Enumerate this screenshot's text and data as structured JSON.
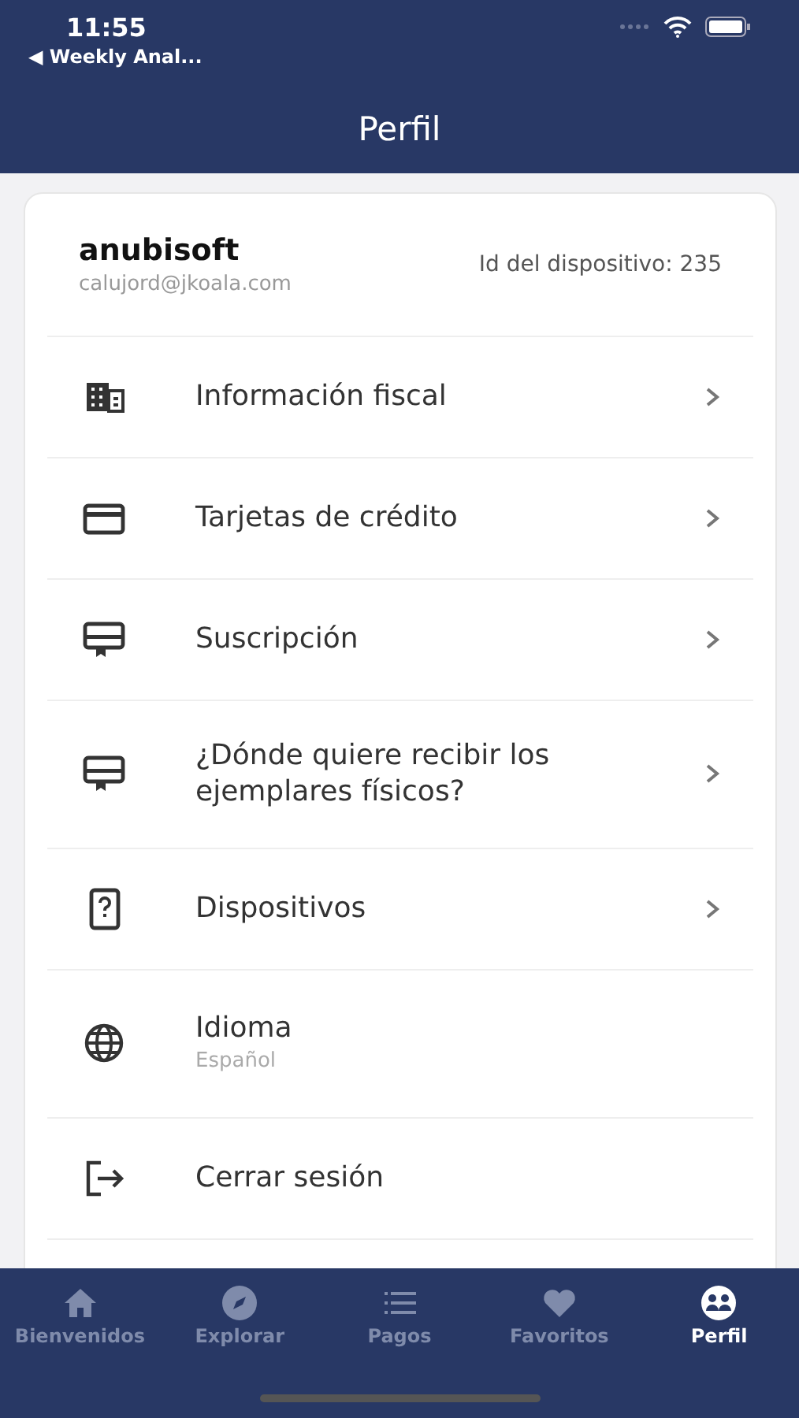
{
  "status_bar": {
    "time": "11:55",
    "back_app": "◀ Weekly Anal..."
  },
  "header": {
    "title": "Perfil"
  },
  "profile": {
    "name": "anubisoft",
    "email": "calujord@jkoala.com",
    "device_id": "Id del dispositivo: 235"
  },
  "menu": [
    {
      "label": "Información fiscal",
      "chevron": true
    },
    {
      "label": "Tarjetas de crédito",
      "chevron": true
    },
    {
      "label": "Suscripción",
      "chevron": true
    },
    {
      "label": "¿Dónde quiere recibir los ejemplares físicos?",
      "chevron": true
    },
    {
      "label": "Dispositivos",
      "chevron": true
    },
    {
      "label": "Idioma",
      "subtitle": "Español",
      "chevron": false
    },
    {
      "label": "Cerrar sesión",
      "chevron": false
    }
  ],
  "tab_bar": [
    {
      "label": "Bienvenidos",
      "selected": false
    },
    {
      "label": "Explorar",
      "selected": false
    },
    {
      "label": "Pagos",
      "selected": false
    },
    {
      "label": "Favoritos",
      "selected": false
    },
    {
      "label": "Perfil",
      "selected": true
    }
  ]
}
